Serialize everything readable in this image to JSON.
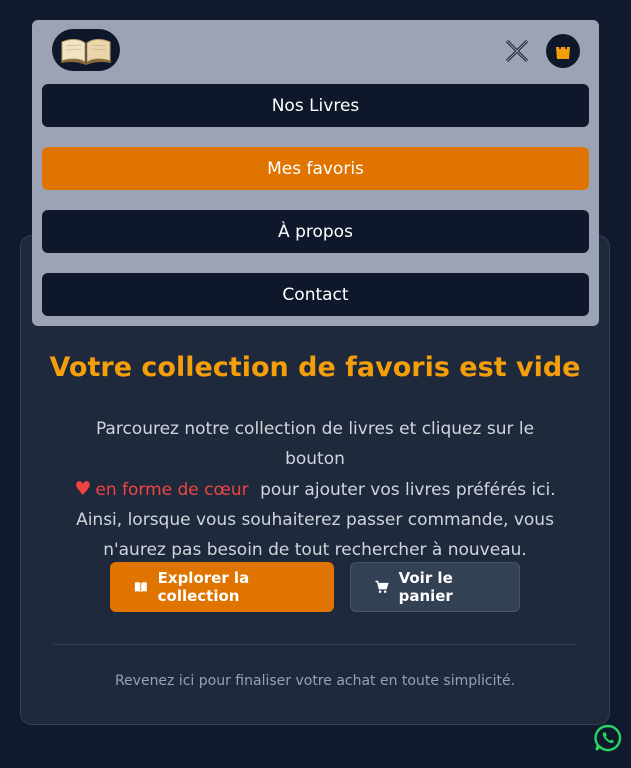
{
  "menu": {
    "logo": "open-book-icon",
    "close": "close-icon",
    "cart": "shopping-bag-icon",
    "items": [
      {
        "label": "Nos Livres",
        "active": false
      },
      {
        "label": "Mes favoris",
        "active": true
      },
      {
        "label": "À propos",
        "active": false
      },
      {
        "label": "Contact",
        "active": false
      }
    ]
  },
  "empty_state": {
    "title": "Votre collection de favoris est vide",
    "text_before": "Parcourez notre collection de livres et cliquez sur le bouton",
    "heart_label": "en forme de cœur",
    "text_after": "pour ajouter vos livres préférés ici. Ainsi, lorsque vous souhaiterez passer commande, vous n'aurez pas besoin de tout rechercher à nouveau.",
    "primary_button": "Explorer la collection",
    "secondary_button": "Voir le panier",
    "footnote": "Revenez ici pour finaliser votre achat en toute simplicité."
  },
  "colors": {
    "accent": "#e07400",
    "title": "#f59e0b",
    "heart": "#ef4444",
    "background": "#111a2c",
    "card": "#1e293b",
    "whatsapp": "#25d366"
  }
}
